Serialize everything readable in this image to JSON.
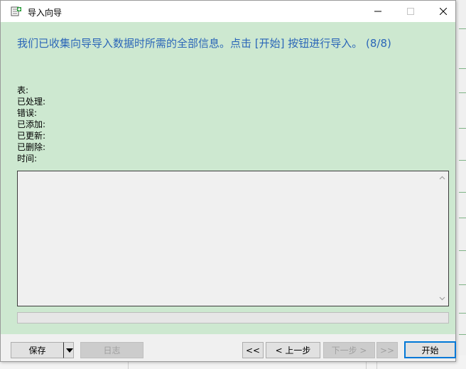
{
  "window": {
    "title": "导入向导",
    "controls": {
      "minimize": "—",
      "maximize": "☐",
      "close": "✕"
    }
  },
  "main": {
    "headline": "我们已收集向导导入数据时所需的全部信息。点击 [开始] 按钮进行导入。 (8/8)",
    "stats": [
      {
        "label": "表:"
      },
      {
        "label": "已处理:"
      },
      {
        "label": "错误:"
      },
      {
        "label": "已添加:"
      },
      {
        "label": "已更新:"
      },
      {
        "label": "已删除:"
      },
      {
        "label": "时间:"
      }
    ],
    "log_text": "",
    "progress": 0
  },
  "footer": {
    "save": "保存",
    "log": "日志",
    "first": "<<",
    "prev": "< 上一步",
    "next": "下一步 >",
    "last": ">>",
    "start": "开始"
  },
  "colors": {
    "content_bg": "#cde8d0",
    "headline": "#2b66b8",
    "primary_border": "#0078d7"
  },
  "icons": {
    "app": "import-wizard-icon",
    "scroll_up": "chevron-up-icon",
    "scroll_down": "chevron-down-icon",
    "dropdown": "caret-down-icon"
  }
}
